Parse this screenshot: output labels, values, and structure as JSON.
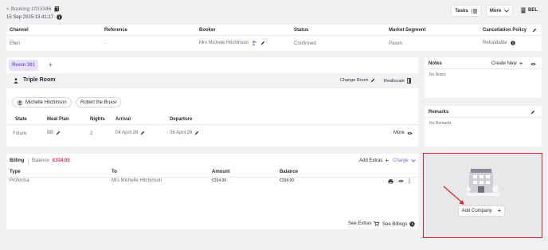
{
  "header": {
    "booking_ref": "< Booking 1013346",
    "datetime": "15 Sep 2025 13:41:17",
    "tasks_label": "Tasks",
    "more_label": "More",
    "lang_label": "BEL"
  },
  "summary": {
    "columns": [
      "Channel",
      "Reference",
      "Booker",
      "Status",
      "Market Segment",
      "Cancellation Policy"
    ],
    "values": [
      "Ellen",
      "-",
      "Mrs Michele Hitchinson",
      "Confirmed",
      "Pasen",
      "Refundable"
    ]
  },
  "room": {
    "tab_label": "Room 301",
    "add_tab": "+",
    "room_type": "Triple Room",
    "change_room": "Change Room",
    "reallocate": "Reallocate",
    "guests": [
      "Michelle Hitchinson",
      "Robert the Bruce"
    ],
    "columns": [
      "State",
      "Meal Plan",
      "Nights",
      "Arrival",
      "Departure"
    ],
    "values": [
      "Future",
      "BB",
      "2",
      "04 April 26",
      "06 April 26"
    ],
    "more_label": "More"
  },
  "notes": {
    "title": "Notes",
    "create_new": "Create New",
    "empty": "No Notes"
  },
  "remarks": {
    "title": "Remarks",
    "empty": "No Remarks"
  },
  "billing": {
    "title": "Billing",
    "balance_label": "Balance:",
    "balance_value": "€334.00",
    "add_extras": "Add Extras",
    "charge": "Charge",
    "columns": [
      "Type",
      "To",
      "Amount",
      "Balance"
    ],
    "row": [
      "Proforma",
      "Mrs Michelle Hitchinson",
      "€334.00",
      "€334.00"
    ],
    "see_extras": "See Extras",
    "see_billings": "See Billings"
  },
  "company": {
    "add_label": "Add Company",
    "plus": "+"
  },
  "colors": {
    "accent": "#7b5cd6",
    "balance_red": "#d6226e",
    "highlight_border": "#e0202a",
    "arrow": "#d6201f"
  }
}
